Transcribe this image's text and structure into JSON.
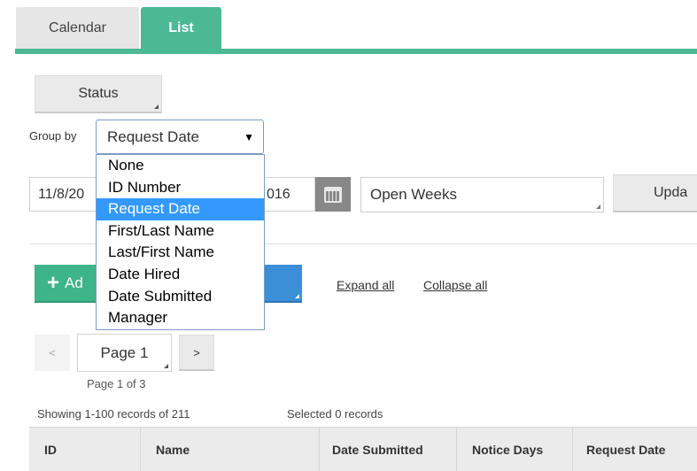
{
  "tabs": [
    {
      "label": "Calendar",
      "active": false
    },
    {
      "label": "List",
      "active": true
    }
  ],
  "accent_color": "#4db894",
  "status_button": {
    "label": "Status"
  },
  "group_by": {
    "label": "Group by",
    "selected": "Request Date",
    "options": [
      "None",
      "ID Number",
      "Request Date",
      "First/Last Name",
      "Last/First Name",
      "Date Hired",
      "Date Submitted",
      "Manager"
    ]
  },
  "date_range": {
    "value_start": "11/8/20",
    "value_end": "016"
  },
  "weeks_select": {
    "value": "Open Weeks"
  },
  "update_button": {
    "label": "Upda"
  },
  "add_button": {
    "label": "Ad"
  },
  "links": {
    "expand_all": "Expand all",
    "collapse_all": "Collapse all"
  },
  "pagination": {
    "prev": "<",
    "next": ">",
    "current_page": "Page 1",
    "info": "Page 1 of 3"
  },
  "records": {
    "showing": "Showing 1-100 records of 211",
    "selected": "Selected 0 records"
  },
  "table": {
    "columns": [
      "ID",
      "Name",
      "Date Submitted",
      "Notice Days",
      "Request Date"
    ]
  },
  "icons": {
    "calendar": "calendar-icon",
    "add": "plus-icon",
    "caret": "chevron-down-icon"
  }
}
